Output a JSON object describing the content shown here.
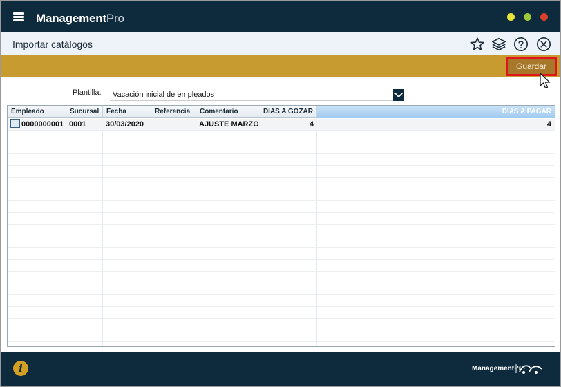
{
  "app": {
    "brand_bold": "Management",
    "brand_light": "Pro"
  },
  "page": {
    "title": "Importar catálogos"
  },
  "toolbar": {
    "save_label": "Guardar"
  },
  "template": {
    "label": "Plantilla:",
    "value": "Vacación inicial de empleados"
  },
  "grid": {
    "columns": [
      "Empleado",
      "Sucursal",
      "Fecha",
      "Referencia",
      "Comentario",
      "DIAS A GOZAR",
      "DIAS A PAGAR"
    ],
    "rows": [
      [
        "0000000001",
        "0001",
        "30/03/2020",
        "",
        "AJUSTE MARZO",
        "4",
        "4"
      ]
    ]
  },
  "footer": {
    "brand_bold": "Management",
    "brand_light": "Pro"
  },
  "icons": {
    "menu": "hamburger-icon",
    "favorite": "star-icon",
    "layers": "layers-icon",
    "help": "help-icon",
    "close": "close-icon",
    "info": "info-icon",
    "dropdown": "chevron-down-icon"
  },
  "colors": {
    "topbar": "#0e2a3d",
    "actionbar": "#c89b30",
    "save_button": "#a7772a",
    "highlight": "#e0151b"
  }
}
